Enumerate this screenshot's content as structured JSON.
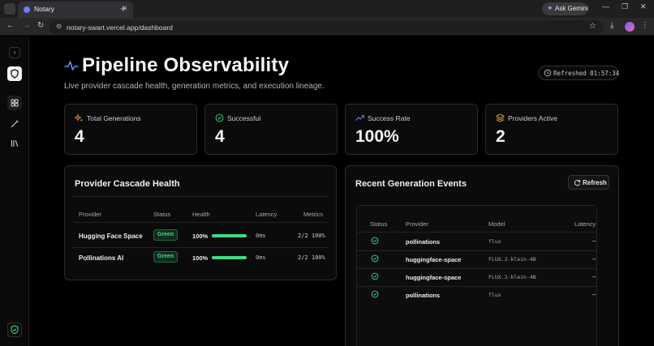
{
  "browser": {
    "tab_title": "Notary",
    "url": "notary-swart.vercel.app/dashboard",
    "gemini_label": "Ask Gemini"
  },
  "header": {
    "title": "Pipeline Observability",
    "subtitle": "Live provider cascade health, generation metrics, and execution lineage.",
    "refreshed": "Refreshed 01:57:34"
  },
  "stats": [
    {
      "label": "Total Generations",
      "value": "4",
      "icon": "sparkles-icon",
      "color": "#e8913a"
    },
    {
      "label": "Successful",
      "value": "4",
      "icon": "check-circle-icon",
      "color": "#3ddc84"
    },
    {
      "label": "Success Rate",
      "value": "100%",
      "icon": "trending-up-icon",
      "color": "#5b8def"
    },
    {
      "label": "Providers Active",
      "value": "2",
      "icon": "layers-icon",
      "color": "#e8b23a"
    }
  ],
  "cascade": {
    "title": "Provider Cascade Health",
    "headers": [
      "Provider",
      "Status",
      "Health",
      "Latency",
      "Metrics"
    ],
    "rows": [
      {
        "provider": "Hugging Face Space",
        "status": "Green",
        "health": "100%",
        "health_fraction": 1.0,
        "latency": "0ms",
        "metrics": "2/2 100%"
      },
      {
        "provider": "Pollinations AI",
        "status": "Green",
        "health": "100%",
        "health_fraction": 1.0,
        "latency": "0ms",
        "metrics": "2/2 100%"
      }
    ]
  },
  "events": {
    "title": "Recent Generation Events",
    "refresh_label": "Refresh",
    "headers": [
      "Status",
      "Provider",
      "Model",
      "Latency"
    ],
    "rows": [
      {
        "provider": "pollinations",
        "model": "flux",
        "latency": "–"
      },
      {
        "provider": "huggingface-space",
        "model": "FLUX.2-klein-4B",
        "latency": "–"
      },
      {
        "provider": "huggingface-space",
        "model": "FLUX.2-klein-4B",
        "latency": "–"
      },
      {
        "provider": "pollinations",
        "model": "flux",
        "latency": "–"
      }
    ]
  },
  "colors": {
    "accent_green": "#3ddc84",
    "title_icon": "#5b8def"
  }
}
